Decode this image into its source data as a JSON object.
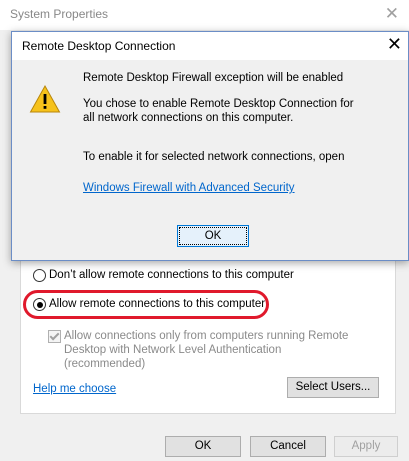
{
  "background_window": {
    "title": "System Properties",
    "close_glyph": "✕",
    "radio_dont_allow": "Don’t allow remote connections to this computer",
    "radio_allow": "Allow remote connections to this computer",
    "nla_checkbox": "Allow connections only from computers running Remote Desktop with Network Level Authentication (recommended)",
    "help_link": "Help me choose",
    "select_users": "Select Users...",
    "buttons": {
      "ok": "OK",
      "cancel": "Cancel",
      "apply": "Apply"
    }
  },
  "dialog": {
    "title": "Remote Desktop Connection",
    "close_glyph": "✕",
    "heading": "Remote Desktop Firewall exception will be enabled",
    "body_line1": "You chose to enable Remote Desktop Connection for",
    "body_line2": "all network connections on this computer.",
    "body_line3": "To enable it for selected network connections, open",
    "link": "Windows Firewall with Advanced Security",
    "ok": "OK",
    "icon": "warning-icon"
  },
  "colors": {
    "highlight_ring": "#e0192c",
    "link": "#0066cc",
    "focus_button": "#0078d7",
    "warning_fill": "#f6c21b"
  }
}
